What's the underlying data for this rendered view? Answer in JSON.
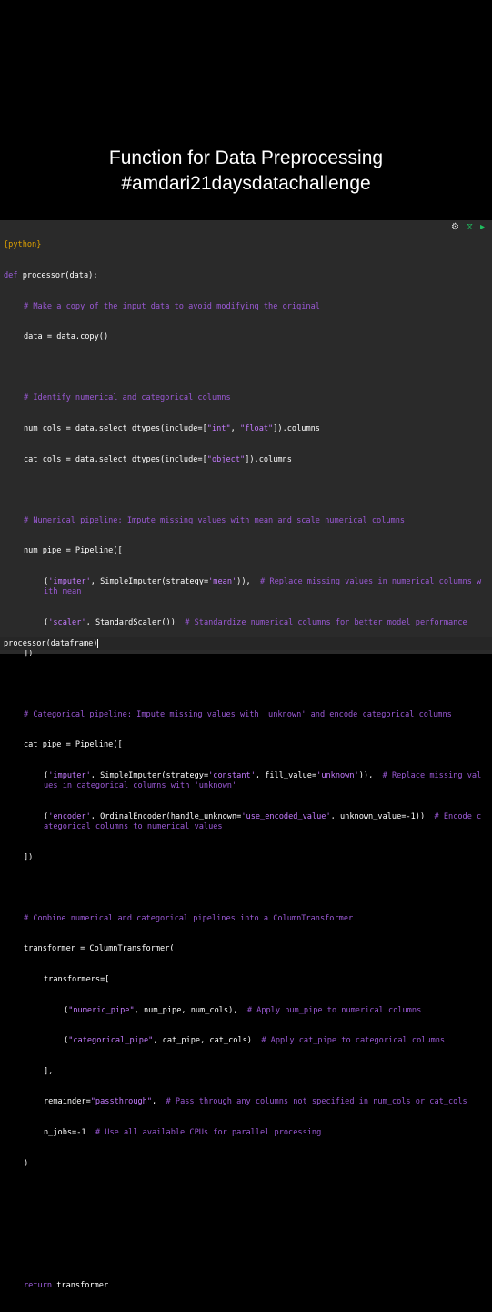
{
  "title": {
    "line1": "Function for Data Preprocessing",
    "line2": "#amdari21daysdatachallenge"
  },
  "editor": {
    "language_tag": "{python}",
    "icons": [
      "gear-icon",
      "collapse-icon",
      "run-icon"
    ],
    "lines": {
      "l1_kw": "def",
      "l1_rest": "processor(data):",
      "l2": "# Make a copy of the input data to avoid modifying the original",
      "l3": "data = data.copy()",
      "l4": "",
      "l5": "# Identify numerical and categorical columns",
      "l6a": "num_cols = data.select_dtypes(include=[",
      "l6s1": "\"int\"",
      "l6b": ", ",
      "l6s2": "\"float\"",
      "l6c": "]).columns",
      "l7a": "cat_cols = data.select_dtypes(include=[",
      "l7s1": "\"object\"",
      "l7b": "]).columns",
      "l8": "",
      "l9": "# Numerical pipeline: Impute missing values with mean and scale numerical columns",
      "l10": "num_pipe = Pipeline([",
      "l11a": "(",
      "l11s1": "'imputer'",
      "l11b": ", SimpleImputer(strategy=",
      "l11s2": "'mean'",
      "l11c": ")),  ",
      "l11cm": "# Replace missing values in numerical columns with mean",
      "l12a": "(",
      "l12s1": "'scaler'",
      "l12b": ", StandardScaler())  ",
      "l12cm": "# Standardize numerical columns for better model performance",
      "l13": "])",
      "l14": "",
      "l15": "# Categorical pipeline: Impute missing values with 'unknown' and encode categorical columns",
      "l16": "cat_pipe = Pipeline([",
      "l17a": "(",
      "l17s1": "'imputer'",
      "l17b": ", SimpleImputer(strategy=",
      "l17s2": "'constant'",
      "l17c": ", fill_value=",
      "l17s3": "'unknown'",
      "l17d": ")),  ",
      "l17cm": "# Replace missing values in categorical columns with 'unknown'",
      "l18a": "(",
      "l18s1": "'encoder'",
      "l18b": ", OrdinalEncoder(handle_unknown=",
      "l18s2": "'use_encoded_value'",
      "l18c": ", unknown_value=-1))  ",
      "l18cm": "# Encode categorical columns to numerical values",
      "l19": "])",
      "l20": "",
      "l21": "# Combine numerical and categorical pipelines into a ColumnTransformer",
      "l22": "transformer = ColumnTransformer(",
      "l23": "transformers=[",
      "l24a": "(",
      "l24s1": "\"numeric_pipe\"",
      "l24b": ", num_pipe, num_cols),  ",
      "l24cm": "# Apply num_pipe to numerical columns",
      "l25a": "(",
      "l25s1": "\"categorical_pipe\"",
      "l25b": ", cat_pipe, cat_cols)  ",
      "l25cm": "# Apply cat_pipe to categorical columns",
      "l26": "],",
      "l27a": "remainder=",
      "l27s1": "\"passthrough\"",
      "l27b": ",  ",
      "l27cm": "# Pass through any columns not specified in num_cols or cat_cols",
      "l28a": "n_jobs=-1  ",
      "l28cm": "# Use all available CPUs for parallel processing",
      "l29": ")",
      "l33_kw": "return",
      "l33_rest": " transformer"
    },
    "console": "processor(dataframe)"
  },
  "colors": {
    "background": "#000000",
    "editor_bg": "#2a2a2a",
    "comment": "#9b59d6",
    "string": "#c57bff",
    "keyword": "#a05fe0",
    "tag": "#e0a200"
  }
}
